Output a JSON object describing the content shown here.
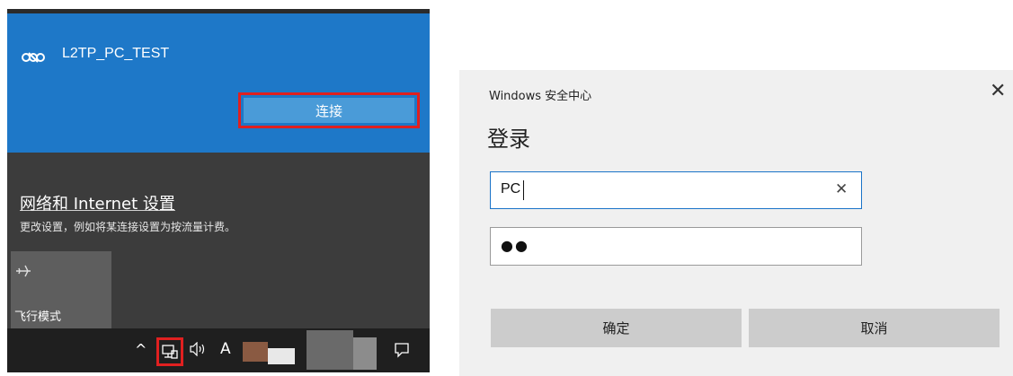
{
  "flyout": {
    "vpn_connection": {
      "name": "L2TP_PC_TEST",
      "icon": "vpn-link-icon",
      "connect_label": "连接"
    },
    "settings": {
      "link_label": "网络和 Internet 设置",
      "description": "更改设置，例如将某连接设置为按流量计费。"
    },
    "quick_actions": [
      {
        "label": "飞行模式",
        "icon": "airplane-icon"
      }
    ],
    "taskbar": {
      "chevron": "^",
      "ime": "A",
      "icons": [
        "show-hidden-icons-icon",
        "network-icon",
        "volume-icon",
        "action-center-icon"
      ]
    }
  },
  "dialog": {
    "title": "Windows 安全中心",
    "close_glyph": "✕",
    "heading": "登录",
    "username": {
      "value": "PC",
      "clear_glyph": "✕"
    },
    "password": {
      "mask": "●●"
    },
    "ok_label": "确定",
    "cancel_label": "取消"
  },
  "colors": {
    "accent_blue": "#1e78c8",
    "connect_button": "#4a9bd8",
    "highlight_red": "#e02020",
    "flyout_bg": "#3c3c3c",
    "dialog_bg": "#f0f0f0"
  }
}
